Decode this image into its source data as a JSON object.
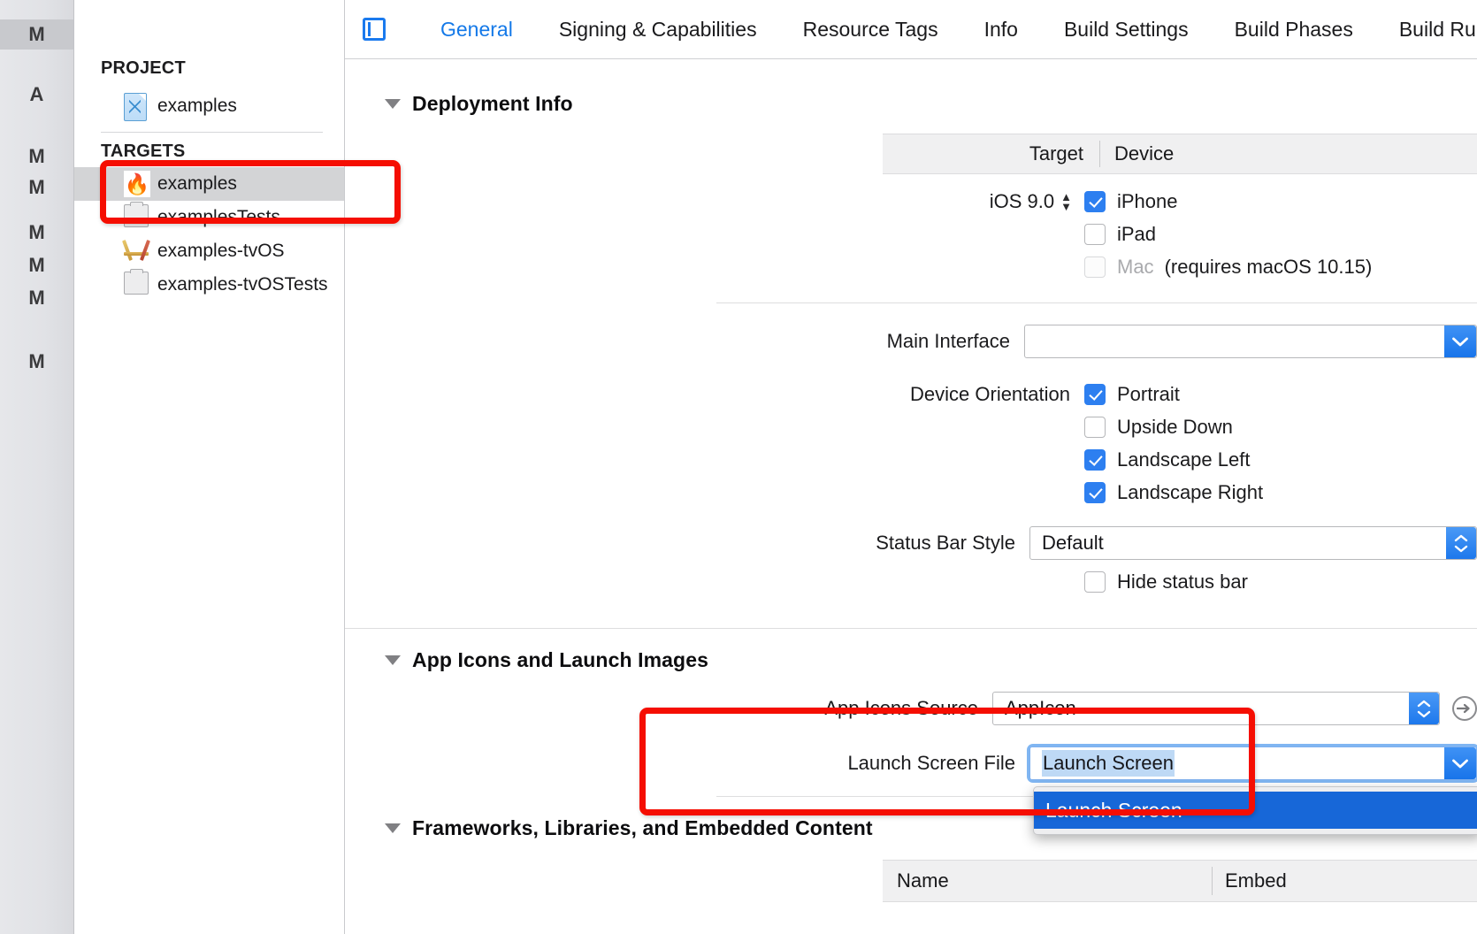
{
  "window": {
    "vcs_marks": [
      {
        "letter": "M",
        "selected": true
      },
      {
        "letter": "A",
        "selected": false
      },
      {
        "letter": "M",
        "selected": false
      },
      {
        "letter": "M",
        "selected": false
      },
      {
        "letter": "M",
        "selected": false
      },
      {
        "letter": "M",
        "selected": false
      },
      {
        "letter": "M",
        "selected": false
      },
      {
        "letter": "M",
        "selected": false
      }
    ]
  },
  "tabs": {
    "items": [
      {
        "label": "General",
        "active": true
      },
      {
        "label": "Signing & Capabilities",
        "active": false
      },
      {
        "label": "Resource Tags",
        "active": false
      },
      {
        "label": "Info",
        "active": false
      },
      {
        "label": "Build Settings",
        "active": false
      },
      {
        "label": "Build Phases",
        "active": false
      },
      {
        "label": "Build Ru",
        "active": false
      }
    ]
  },
  "navigator": {
    "project_header": "PROJECT",
    "project_item": {
      "label": "examples",
      "icon": "project-file-icon"
    },
    "targets_header": "TARGETS",
    "targets": [
      {
        "label": "examples",
        "icon": "flame-icon",
        "selected": true
      },
      {
        "label": "examplesTests",
        "icon": "test-bundle-icon",
        "selected": false
      },
      {
        "label": "examples-tvOS",
        "icon": "tvos-app-icon",
        "selected": false
      },
      {
        "label": "examples-tvOSTests",
        "icon": "test-bundle-icon",
        "selected": false
      }
    ]
  },
  "deployment": {
    "section_title": "Deployment Info",
    "col_target": "Target",
    "col_device": "Device",
    "deployment_target": "iOS 9.0",
    "devices": [
      {
        "label": "iPhone",
        "checked": true,
        "disabled": false,
        "note": ""
      },
      {
        "label": "iPad",
        "checked": false,
        "disabled": false,
        "note": ""
      },
      {
        "label": "Mac",
        "checked": false,
        "disabled": true,
        "note": "(requires macOS 10.15)"
      }
    ],
    "main_interface_label": "Main Interface",
    "main_interface_value": "",
    "orientation_label": "Device Orientation",
    "orientations": [
      {
        "label": "Portrait",
        "checked": true
      },
      {
        "label": "Upside Down",
        "checked": false
      },
      {
        "label": "Landscape Left",
        "checked": true
      },
      {
        "label": "Landscape Right",
        "checked": true
      }
    ],
    "status_bar_label": "Status Bar Style",
    "status_bar_value": "Default",
    "hide_status_bar_label": "Hide status bar",
    "hide_status_bar_checked": false
  },
  "app_icons": {
    "section_title": "App Icons and Launch Images",
    "app_icons_source_label": "App Icons Source",
    "app_icons_source_value": "AppIcon",
    "launch_screen_label": "Launch Screen File",
    "launch_screen_value": "Launch Screen",
    "dropdown_options": [
      {
        "label": "Launch Screen",
        "highlighted": true
      }
    ]
  },
  "frameworks": {
    "section_title": "Frameworks, Libraries, and Embedded Content",
    "col_name": "Name",
    "col_embed": "Embed"
  },
  "colors": {
    "accent_blue": "#1479e8",
    "checkbox_blue": "#2d7ff0",
    "dropdown_highlight": "#1767d8",
    "annotation_red": "#f50e02",
    "selection_blue": "#bed9f5"
  }
}
